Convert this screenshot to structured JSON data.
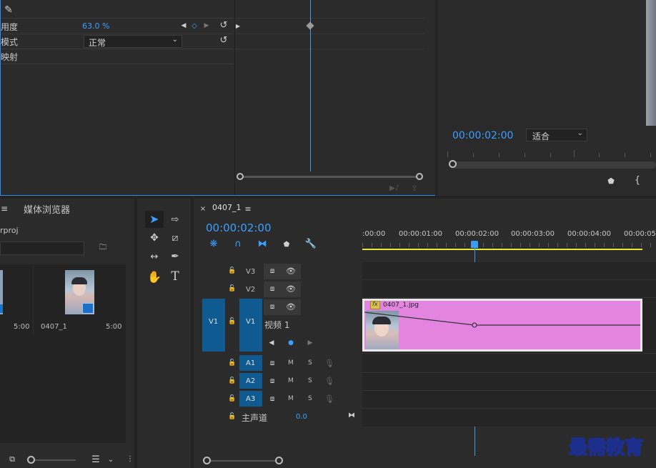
{
  "effect_controls": {
    "opacity_label": "用度",
    "opacity_value": "63.0 %",
    "blend_label": "模式",
    "blend_value": "正常",
    "remap_label": "映射"
  },
  "program": {
    "timecode": "00:00:02:00",
    "fit_value": "适合"
  },
  "project": {
    "tab_label": "媒体浏览器",
    "file_label": "rproj",
    "left_clip_duration": "5:00",
    "clip_name": "0407_1",
    "clip_duration": "5:00"
  },
  "timeline": {
    "sequence_name": "0407_1",
    "timecode": "00:00:02:00",
    "ruler": [
      ":00:00",
      "00:00:01:00",
      "00:00:02:00",
      "00:00:03:00",
      "00:00:04:00",
      "00:00:05:"
    ],
    "tracks": {
      "v3": "V3",
      "v2": "V2",
      "v1": "V1",
      "v1_source": "V1",
      "video1_label": "视频 1",
      "a1": "A1",
      "a2": "A2",
      "a3": "A3",
      "m": "M",
      "s": "S",
      "master_label": "主声道",
      "master_value": "0.0"
    },
    "clip_filename": "0407_1.jpg",
    "fx_badge": "fx"
  },
  "watermark": "最需教育",
  "colors": {
    "accent": "#3aa0ff",
    "clip": "#e385e0",
    "track_target": "#0e5a91",
    "work_area": "#e4e43a"
  }
}
